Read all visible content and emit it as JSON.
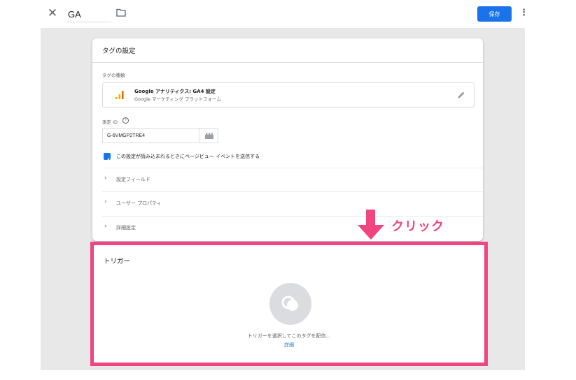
{
  "header": {
    "tag_name": "GA",
    "save_label": "保存"
  },
  "tag_config": {
    "title": "タグの設定",
    "tag_type_label": "タグの種類",
    "tag_type": {
      "title": "Google アナリティクス: GA4 設定",
      "subtitle": "Google マーケティング プラットフォーム",
      "icon": "analytics-bars-icon"
    },
    "measurement_id_label": "測定 ID",
    "measurement_id_value": "G-6VMGP2TRE4",
    "pageview_checkbox": {
      "label": "この設定が読み込まれるときにページビュー イベントを送信する",
      "checked": true
    },
    "sections": [
      {
        "label": "設定フィールド"
      },
      {
        "label": "ユーザー プロパティ"
      },
      {
        "label": "詳細設定"
      }
    ]
  },
  "annotation": {
    "label": "クリック",
    "color": "#f0457e"
  },
  "trigger": {
    "title": "トリガー",
    "placeholder_text": "トリガーを選択してこのタグを配信...",
    "link_label": "詳細"
  },
  "colors": {
    "accent": "#1a73e8",
    "highlight": "#f0457e",
    "workspace": "#e8e8e8"
  }
}
